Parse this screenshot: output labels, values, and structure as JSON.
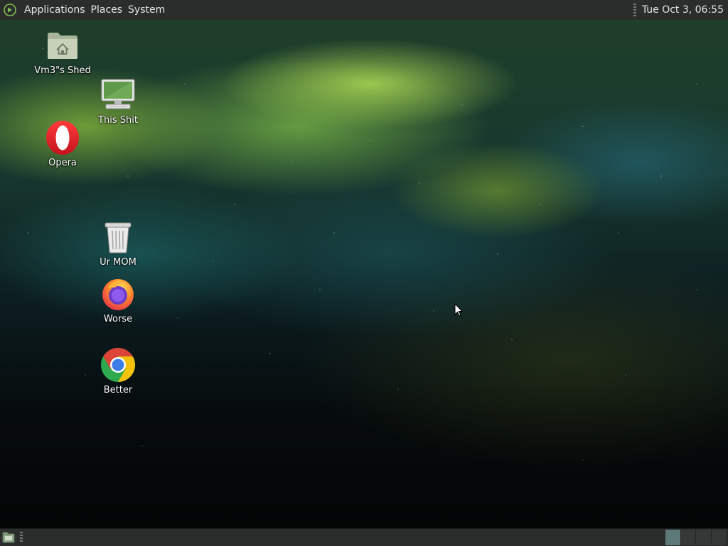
{
  "top_panel": {
    "menus": [
      "Applications",
      "Places",
      "System"
    ],
    "clock": "Tue Oct  3, 06:55"
  },
  "desktop_icons": [
    {
      "label": "Vm3\"s Shed",
      "icon": "home-folder-icon"
    },
    {
      "label": "This Shit",
      "icon": "computer-icon"
    },
    {
      "label": "Opera",
      "icon": "opera-icon"
    },
    {
      "label": "Ur MOM",
      "icon": "trash-icon"
    },
    {
      "label": "Worse",
      "icon": "firefox-icon"
    },
    {
      "label": "Better",
      "icon": "chrome-icon"
    }
  ],
  "bottom_panel": {
    "workspaces": 4,
    "active_workspace": 1
  },
  "colors": {
    "panel": "#2b2d2d",
    "panel_text": "#e4e4e4",
    "workspace_active": "#5e7a78"
  }
}
